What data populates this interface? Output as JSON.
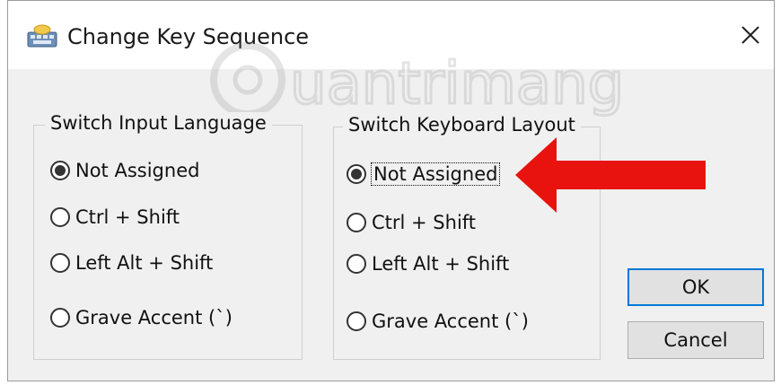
{
  "window": {
    "title": "Change Key Sequence",
    "icon": "keyboard-icon",
    "close_icon": "close-icon"
  },
  "watermark": {
    "text": "Quantrimang"
  },
  "groups": [
    {
      "title": "Switch Input Language",
      "options": [
        {
          "label": "Not Assigned",
          "checked": true
        },
        {
          "label": "Ctrl + Shift",
          "checked": false
        },
        {
          "label": "Left Alt + Shift",
          "checked": false
        },
        {
          "label": "Grave Accent (`)",
          "checked": false
        }
      ]
    },
    {
      "title": "Switch Keyboard Layout",
      "options": [
        {
          "label": "Not Assigned",
          "checked": true
        },
        {
          "label": "Ctrl + Shift",
          "checked": false
        },
        {
          "label": "Left Alt + Shift",
          "checked": false
        },
        {
          "label": "Grave Accent (`)",
          "checked": false
        }
      ]
    }
  ],
  "buttons": {
    "ok": "OK",
    "cancel": "Cancel"
  },
  "annotation": {
    "arrow_color": "#e8130f"
  },
  "colors": {
    "accent": "#0078d7",
    "dialog_bg": "#f0f0f0"
  }
}
